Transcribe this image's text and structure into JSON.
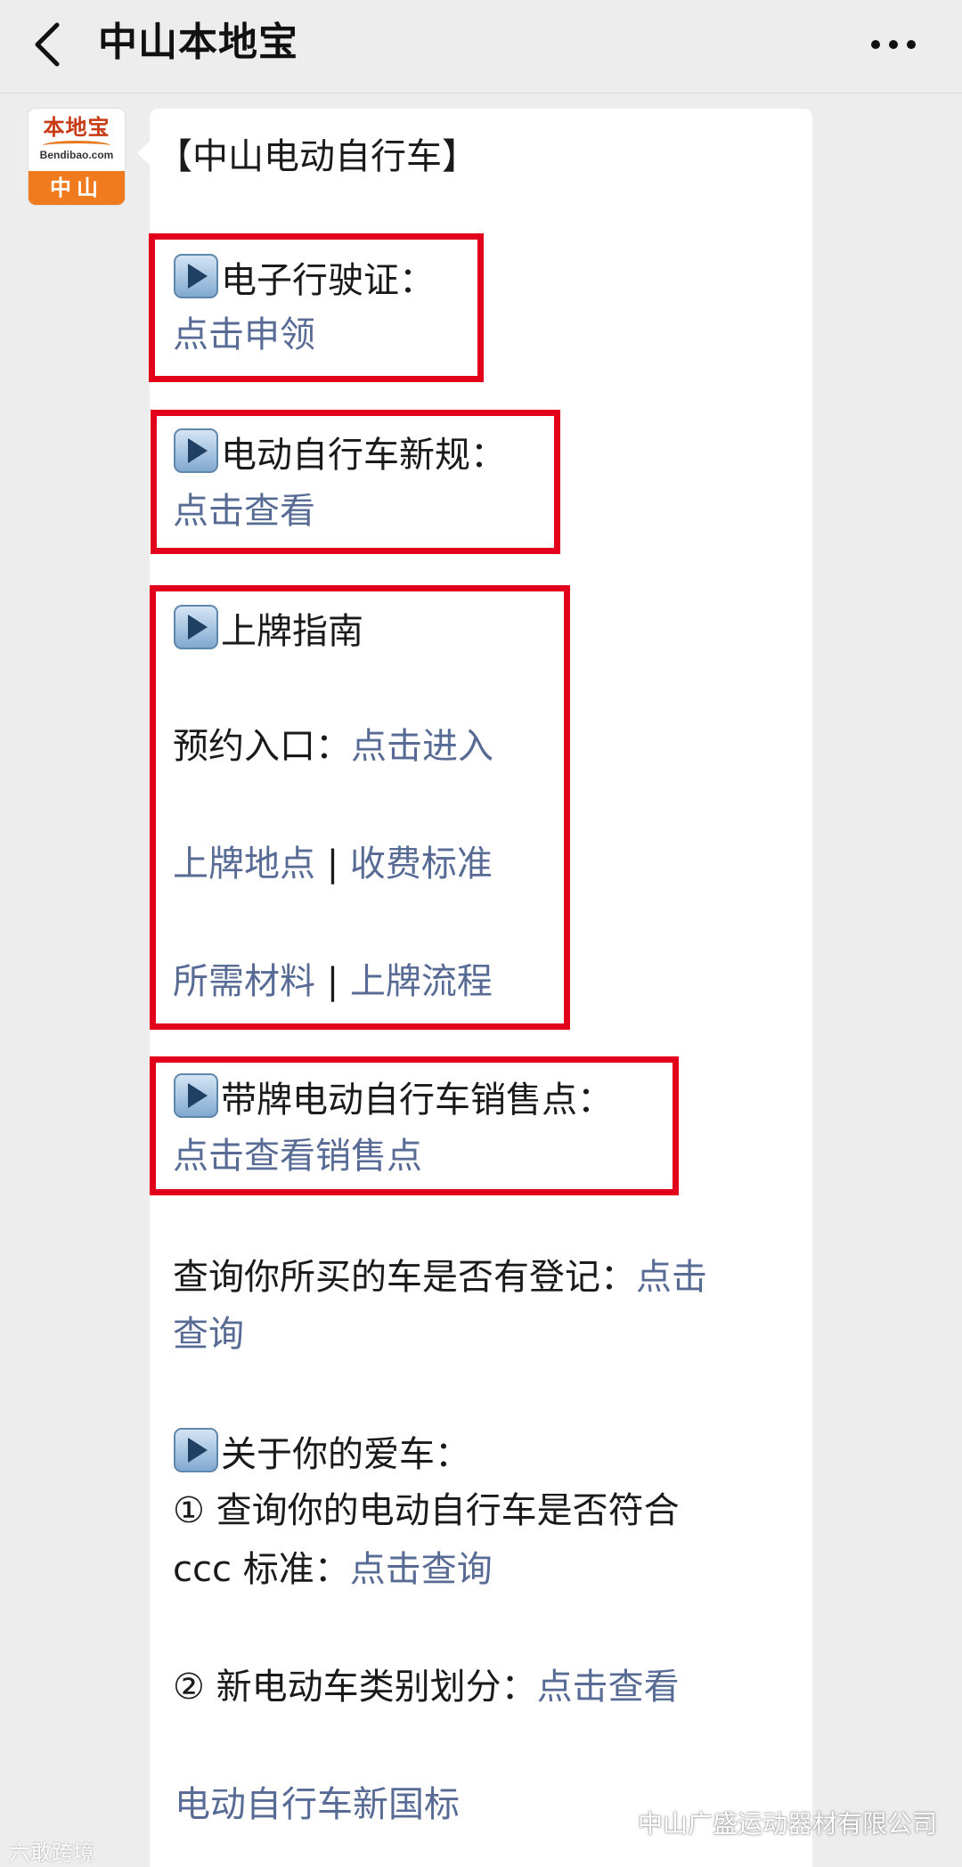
{
  "header": {
    "title": "中山本地宝"
  },
  "avatar": {
    "logo_text": "本地宝",
    "domain": "Bendibao.com",
    "city": "中山"
  },
  "content": {
    "heading": "【中山电动自行车】",
    "license": {
      "label": "电子行驶证：",
      "link": "点击申领"
    },
    "new_rules": {
      "label": "电动自行车新规：",
      "link": "点击查看"
    },
    "plate_guide": {
      "label": "上牌指南",
      "booking_label": "预约入口：",
      "booking_link": "点击进入",
      "location_link": "上牌地点",
      "fee_link": "收费标准",
      "materials_link": "所需材料",
      "process_link": "上牌流程",
      "separator": "|"
    },
    "sales": {
      "label": "带牌电动自行车销售点：",
      "link": "点击查看销售点"
    },
    "registration": {
      "label": "查询你所买的车是否有登记：",
      "link_part1": "点击",
      "link_part2": "查询"
    },
    "about": {
      "label": "关于你的爱车：",
      "item1_text": "① 查询你的电动自行车是否符合",
      "item1_text2": "ccc 标准：",
      "item1_link": "点击查询",
      "item2_text": "② 新电动车类别划分：",
      "item2_link": "点击查看"
    },
    "national_standard_link": "电动自行车新国标"
  },
  "watermarks": {
    "left": "六敢跨境",
    "right": "中山广盛运动器材有限公司"
  },
  "colors": {
    "link": "#576b95",
    "highlight_border": "#e3001b",
    "avatar_orange": "#f07a1e",
    "background": "#ededed"
  }
}
